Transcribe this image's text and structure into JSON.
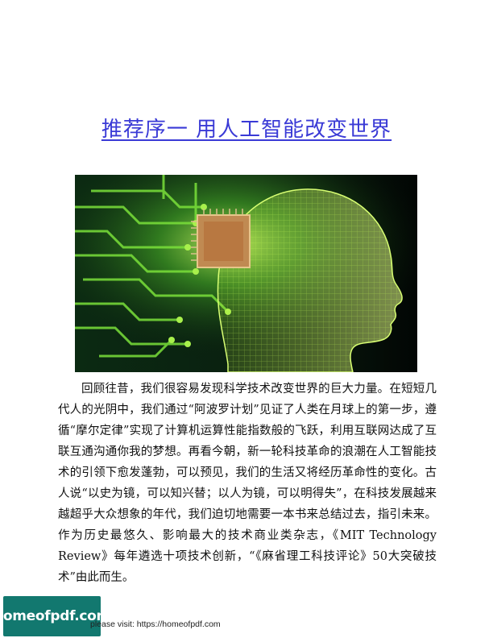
{
  "page": {
    "title": "推荐序一 用人工智能改变世界",
    "paragraph": "回顾往昔，我们很容易发现科学技术改变世界的巨大力量。在短短几代人的光阴中，我们通过“阿波罗计划”见证了人类在月球上的第一步，遵循“摩尔定律”实现了计算机运算性能指数般的飞跃，利用互联网达成了互联互通沟通你我的梦想。再看今朝，新一轮科技革命的浪潮在人工智能技术的引领下愈发蓬勃，可以预见，我们的生活又将经历革命性的变化。古人说“以史为镜，可以知兴替；以人为镜，可以明得失”，在科技发展越来越超乎大众想象的年代，我们迫切地需要一本书来总结过去，指引未来。作为历史最悠久、影响最大的技术商业类杂志，《MIT Technology Review》每年遴选十项技术创新，“《麻省理工科技评论》50大突破技术”由此而生。"
  },
  "footer": {
    "logo_text": "homeofpdf.com",
    "note_prefix": "please visit: ",
    "note_link": "https://homeofpdf.com"
  },
  "colors": {
    "title": "#3a3ad6",
    "logo_bg": "#12786f",
    "circuit": "#7ae03a"
  }
}
